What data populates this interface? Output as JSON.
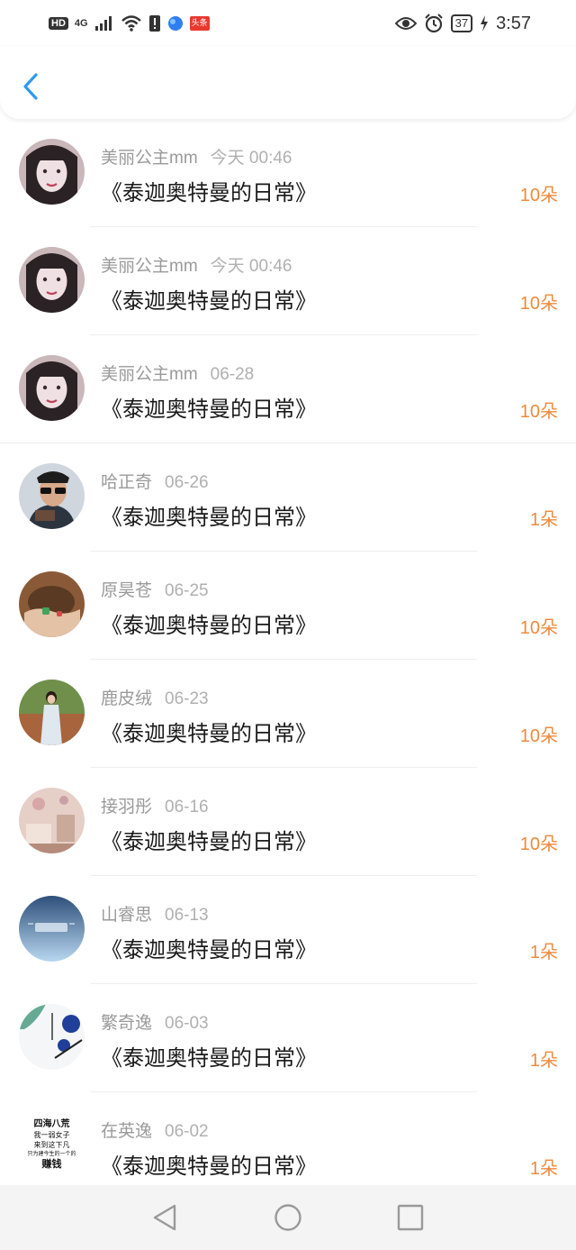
{
  "status_bar": {
    "hd": "HD",
    "network": "4G",
    "battery": "37",
    "time": "3:57",
    "app_badge": "头条"
  },
  "colors": {
    "accent": "#2f9bf0",
    "amount": "#f08a3c",
    "name_gray": "#9a9a9a"
  },
  "items": [
    {
      "name": "美丽公主mm",
      "date": "今天 00:46",
      "title": "《泰迦奥特曼的日常》",
      "amount": "10朵",
      "avatar": "avatar-pink-girl"
    },
    {
      "name": "美丽公主mm",
      "date": "今天 00:46",
      "title": "《泰迦奥特曼的日常》",
      "amount": "10朵",
      "avatar": "avatar-pink-girl"
    },
    {
      "name": "美丽公主mm",
      "date": "06-28",
      "title": "《泰迦奥特曼的日常》",
      "amount": "10朵",
      "avatar": "avatar-pink-girl"
    },
    {
      "name": "哈正奇",
      "date": "06-26",
      "title": "《泰迦奥特曼的日常》",
      "amount": "1朵",
      "avatar": "avatar-man-sunglasses"
    },
    {
      "name": "原昊苍",
      "date": "06-25",
      "title": "《泰迦奥特曼的日常》",
      "amount": "10朵",
      "avatar": "avatar-hands"
    },
    {
      "name": "鹿皮绒",
      "date": "06-23",
      "title": "《泰迦奥特曼的日常》",
      "amount": "10朵",
      "avatar": "avatar-woman-outdoor"
    },
    {
      "name": "接羽彤",
      "date": "06-16",
      "title": "《泰迦奥特曼的日常》",
      "amount": "10朵",
      "avatar": "avatar-room"
    },
    {
      "name": "山睿思",
      "date": "06-13",
      "title": "《泰迦奥特曼的日常》",
      "amount": "1朵",
      "avatar": "avatar-blue-text"
    },
    {
      "name": "繁奇逸",
      "date": "06-03",
      "title": "《泰迦奥特曼的日常》",
      "amount": "1朵",
      "avatar": "avatar-art"
    },
    {
      "name": "在英逸",
      "date": "06-02",
      "title": "《泰迦奥特曼的日常》",
      "amount": "1朵",
      "avatar": "avatar-text-image",
      "avatar_text": [
        "四海八荒",
        "我一弱女子",
        "来到这下凡",
        "只为建今生的一个的",
        "赚钱"
      ]
    }
  ]
}
